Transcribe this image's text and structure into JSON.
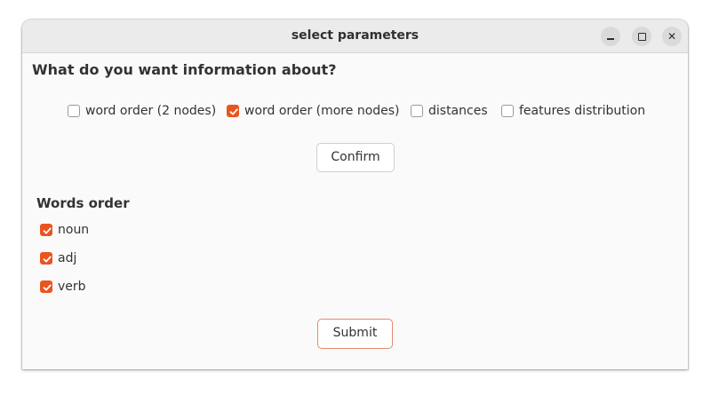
{
  "window": {
    "title": "select parameters"
  },
  "main": {
    "question": "What do you want information about?",
    "options": [
      {
        "label": "word order (2 nodes)",
        "checked": false
      },
      {
        "label": "word order (more nodes)",
        "checked": true
      },
      {
        "label": "distances",
        "checked": false
      },
      {
        "label": "features distribution",
        "checked": false
      }
    ],
    "confirm_label": "Confirm",
    "section_title": "Words order",
    "word_items": [
      {
        "label": "noun",
        "checked": true
      },
      {
        "label": "adj",
        "checked": true
      },
      {
        "label": "verb",
        "checked": true
      }
    ],
    "submit_label": "Submit"
  },
  "colors": {
    "accent": "#e95420",
    "window_bg": "#fafafa",
    "titlebar_bg": "#ebebeb"
  }
}
